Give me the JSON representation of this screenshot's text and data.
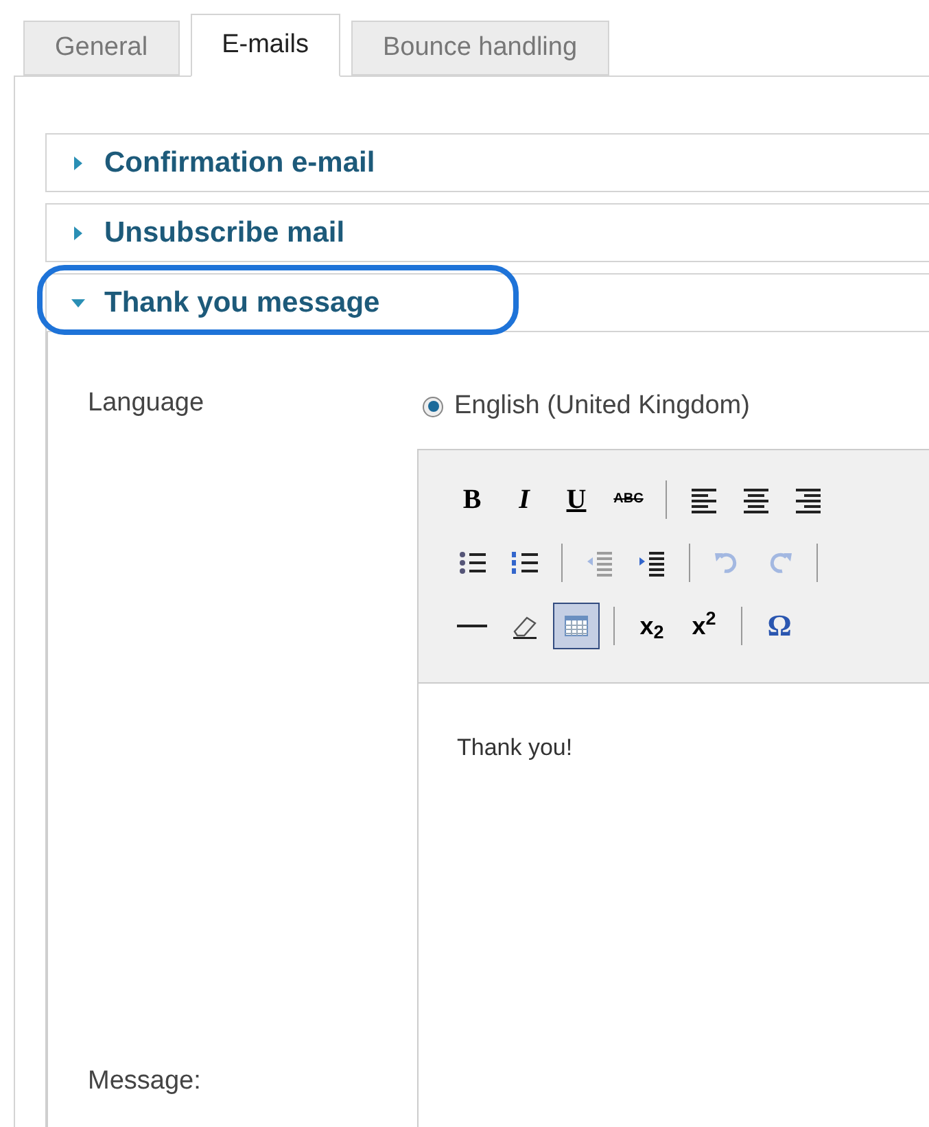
{
  "tabs": [
    {
      "label": "General",
      "selected": false
    },
    {
      "label": "E-mails",
      "selected": true
    },
    {
      "label": "Bounce handling",
      "selected": false
    }
  ],
  "sections": [
    {
      "title": "Confirmation e-mail",
      "expanded": false,
      "highlighted": false
    },
    {
      "title": "Unsubscribe mail",
      "expanded": false,
      "highlighted": false
    },
    {
      "title": "Thank you message",
      "expanded": true,
      "highlighted": true
    }
  ],
  "form": {
    "language_label": "Language",
    "language_option": {
      "label": "English (United Kingdom)",
      "selected": true
    },
    "message_label": "Message:"
  },
  "editor": {
    "toolbar": [
      [
        {
          "kind": "bold",
          "label": "B",
          "selected": false,
          "disabled": false
        },
        {
          "kind": "italic",
          "label": "I",
          "selected": false,
          "disabled": false
        },
        {
          "kind": "underline",
          "label": "U",
          "selected": false,
          "disabled": false
        },
        {
          "kind": "strike",
          "label": "ABC",
          "selected": false,
          "disabled": false
        },
        {
          "kind": "separator"
        },
        {
          "kind": "alignleft",
          "selected": false,
          "disabled": false
        },
        {
          "kind": "aligncenter",
          "selected": false,
          "disabled": false
        },
        {
          "kind": "alignright",
          "selected": false,
          "disabled": false
        }
      ],
      [
        {
          "kind": "bullets",
          "selected": false,
          "disabled": false
        },
        {
          "kind": "numbers",
          "selected": false,
          "disabled": false
        },
        {
          "kind": "separator"
        },
        {
          "kind": "outdent",
          "selected": false,
          "disabled": true
        },
        {
          "kind": "indent",
          "selected": false,
          "disabled": false
        },
        {
          "kind": "separator"
        },
        {
          "kind": "undo",
          "selected": false,
          "disabled": true
        },
        {
          "kind": "redo",
          "selected": false,
          "disabled": true
        },
        {
          "kind": "separator"
        }
      ],
      [
        {
          "kind": "rule",
          "selected": false,
          "disabled": false
        },
        {
          "kind": "eraser",
          "selected": false,
          "disabled": false
        },
        {
          "kind": "table",
          "selected": true,
          "disabled": false
        },
        {
          "kind": "separator"
        },
        {
          "kind": "subscript",
          "label": "x$_{2}$",
          "selected": false,
          "disabled": false
        },
        {
          "kind": "superscript",
          "label": "x$^{2}$",
          "selected": false,
          "disabled": false
        },
        {
          "kind": "separator"
        },
        {
          "kind": "symbol",
          "label": "Ω",
          "selected": false,
          "disabled": false
        }
      ]
    ],
    "content": "Thank you!"
  }
}
